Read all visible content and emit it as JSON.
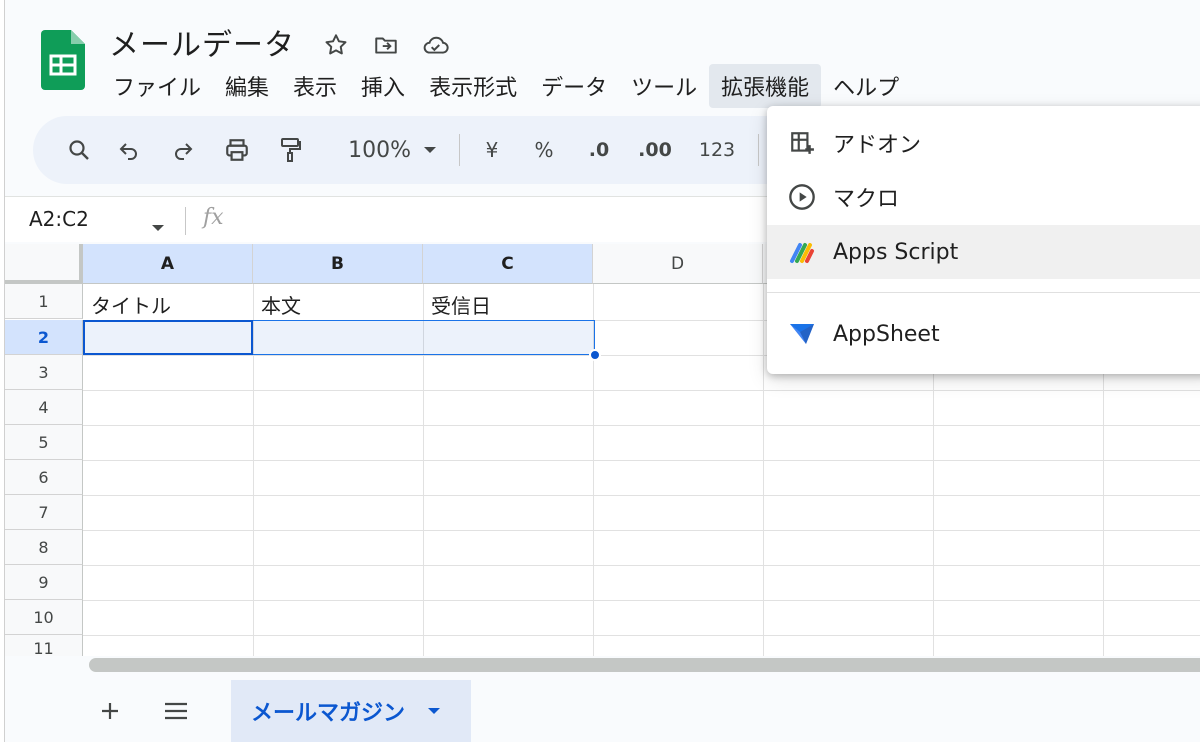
{
  "doc": {
    "title": "メールデータ"
  },
  "menu": [
    "ファイル",
    "編集",
    "表示",
    "挿入",
    "表示形式",
    "データ",
    "ツール",
    "拡張機能",
    "ヘルプ"
  ],
  "toolbar": {
    "zoom": "100%",
    "currency": "¥",
    "percent": "%",
    "dec_decrease": ".0",
    "dec_increase": ".00",
    "number_format": "123"
  },
  "formula": {
    "range": "A2:C2",
    "fx": "fx"
  },
  "columns": [
    "A",
    "B",
    "C",
    "D"
  ],
  "rows": [
    "1",
    "2",
    "3",
    "4",
    "5",
    "6",
    "7",
    "8",
    "9",
    "10",
    "11"
  ],
  "cells": {
    "A1": "タイトル",
    "B1": "本文",
    "C1": "受信日"
  },
  "sheet": {
    "name": "メールマガジン"
  },
  "extensions_menu": {
    "addons": "アドオン",
    "macro": "マクロ",
    "apps_script": "Apps Script",
    "appsheet": "AppSheet"
  },
  "colors": {
    "accent": "#0b57d0",
    "sheets_green": "#0f9d58"
  }
}
